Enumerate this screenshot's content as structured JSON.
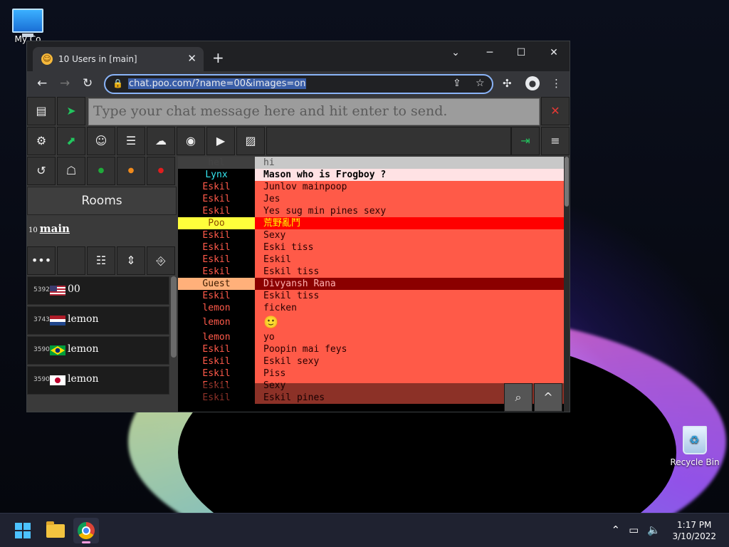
{
  "desktop": {
    "icons": {
      "my_computer": "My Co",
      "recycle_bin": "Recycle Bin"
    }
  },
  "taskbar": {
    "time": "1:17 PM",
    "date": "3/10/2022"
  },
  "browser": {
    "tab_title": "10 Users in [main]",
    "url": "chat.poo.com/?name=00&images=on"
  },
  "chat": {
    "input_placeholder": "Type your chat message here and hit enter to send.",
    "rooms_label": "Rooms",
    "current_room": {
      "count": "10",
      "name": "main"
    },
    "users": [
      {
        "id": "5392",
        "name": "00",
        "flag": "us"
      },
      {
        "id": "3743",
        "name": "lemon",
        "flag": "nl"
      },
      {
        "id": "3590",
        "name": "lemon",
        "flag": "br"
      },
      {
        "id": "3590",
        "name": "lemon",
        "flag": "jp"
      }
    ],
    "messages": [
      {
        "nick": "hel",
        "text": "hi",
        "nick_color": "#444444",
        "nick_bg": "#3f3f3f",
        "msg_bg": "#c8c8c8",
        "msg_color": "#555555"
      },
      {
        "nick": "Lynx",
        "text": "Mason who is Frogboy ?",
        "nick_color": "#35e8f2",
        "nick_bg": "#000000",
        "msg_bg": "#ffe2e4",
        "msg_color": "#000000",
        "bold": true
      },
      {
        "nick": "Eskil",
        "text": "Junlov mainpoop",
        "nick_color": "#ff5a4a",
        "nick_bg": "#000000",
        "msg_bg": "#ff5a48",
        "msg_color": "#2a0000"
      },
      {
        "nick": "Eskil",
        "text": "Jes",
        "nick_color": "#ff5a4a",
        "nick_bg": "#000000",
        "msg_bg": "#ff5a48",
        "msg_color": "#2a0000"
      },
      {
        "nick": "Eskil",
        "text": "Yes sug min pines sexy",
        "nick_color": "#ff5a4a",
        "nick_bg": "#000000",
        "msg_bg": "#ff5a48",
        "msg_color": "#2a0000"
      },
      {
        "nick": "Poo",
        "text": "荒野亂鬥",
        "nick_color": "#8a4a00",
        "nick_bg": "#ffff3b",
        "msg_bg": "#ff0000",
        "msg_color": "#ffff00"
      },
      {
        "nick": "Eskil",
        "text": "Sexy",
        "nick_color": "#ff5a4a",
        "nick_bg": "#000000",
        "msg_bg": "#ff5a48",
        "msg_color": "#2a0000"
      },
      {
        "nick": "Eskil",
        "text": "Eski tiss",
        "nick_color": "#ff5a4a",
        "nick_bg": "#000000",
        "msg_bg": "#ff5a48",
        "msg_color": "#2a0000"
      },
      {
        "nick": "Eskil",
        "text": "Eskil",
        "nick_color": "#ff5a4a",
        "nick_bg": "#000000",
        "msg_bg": "#ff5a48",
        "msg_color": "#2a0000"
      },
      {
        "nick": "Eskil",
        "text": "Eskil tiss",
        "nick_color": "#ff5a4a",
        "nick_bg": "#000000",
        "msg_bg": "#ff5a48",
        "msg_color": "#2a0000"
      },
      {
        "nick": "Guest",
        "text": "Divyansh Rana",
        "nick_color": "#3a1a00",
        "nick_bg": "#ffb07a",
        "msg_bg": "#8b0000",
        "msg_color": "#ffb0b0"
      },
      {
        "nick": "Eskil",
        "text": "Eskil tiss",
        "nick_color": "#ff5a4a",
        "nick_bg": "#000000",
        "msg_bg": "#ff5a48",
        "msg_color": "#2a0000"
      },
      {
        "nick": "lemon",
        "text": "ficken",
        "nick_color": "#ff5a4a",
        "nick_bg": "#000000",
        "msg_bg": "#ff5a48",
        "msg_color": "#2a0000"
      },
      {
        "nick": "lemon",
        "text": "🙂",
        "nick_color": "#ff5a4a",
        "nick_bg": "#000000",
        "msg_bg": "#ff5a48",
        "msg_color": "#e6c200",
        "tall": true
      },
      {
        "nick": "lemon",
        "text": "yo",
        "nick_color": "#ff5a4a",
        "nick_bg": "#000000",
        "msg_bg": "#ff5a48",
        "msg_color": "#2a0000"
      },
      {
        "nick": "Eskil",
        "text": "Poopin mai feys",
        "nick_color": "#ff5a4a",
        "nick_bg": "#000000",
        "msg_bg": "#ff5a48",
        "msg_color": "#2a0000"
      },
      {
        "nick": "Eskil",
        "text": "Eskil sexy",
        "nick_color": "#ff5a4a",
        "nick_bg": "#000000",
        "msg_bg": "#ff5a48",
        "msg_color": "#2a0000"
      },
      {
        "nick": "Eskil",
        "text": "Piss",
        "nick_color": "#ff5a4a",
        "nick_bg": "#000000",
        "msg_bg": "#ff5a48",
        "msg_color": "#2a0000"
      },
      {
        "nick": "Eskil",
        "text": "Sexy",
        "nick_color": "#ff5a4a",
        "nick_bg": "#000000",
        "msg_bg": "#ff5a48",
        "msg_color": "#2a0000"
      },
      {
        "nick": "Eskil",
        "text": "Eskil pines",
        "nick_color": "#ff5a4a",
        "nick_bg": "#000000",
        "msg_bg": "#ff5a48",
        "msg_color": "#2a0000"
      }
    ]
  },
  "colors": {
    "accent_green": "#22c55e",
    "close_red": "#e53935",
    "status_green": "#1faa3a",
    "status_orange": "#f08a1c",
    "status_red": "#e01e1e"
  }
}
